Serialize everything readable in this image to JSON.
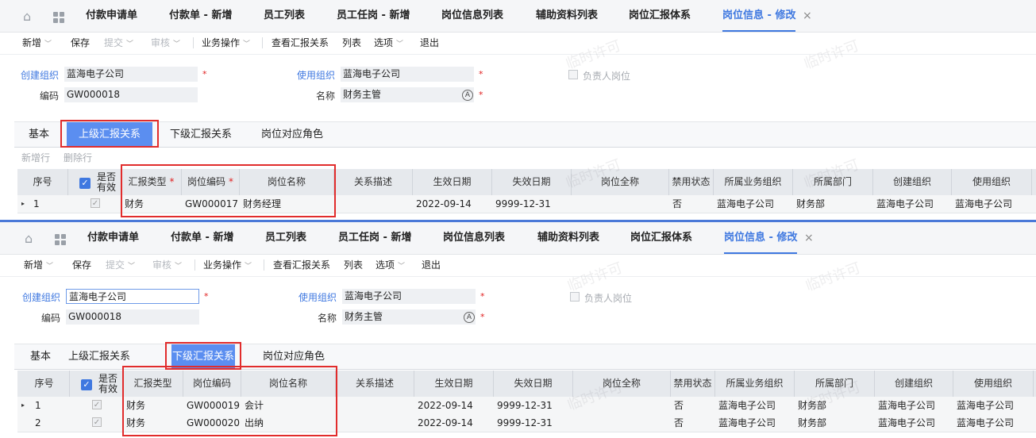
{
  "tabs": [
    "付款申请单",
    "付款单 - 新增",
    "员工列表",
    "员工任岗 - 新增",
    "岗位信息列表",
    "辅助资料列表",
    "岗位汇报体系",
    "岗位信息 - 修改"
  ],
  "tab_close": "×",
  "home_icon": "⌂",
  "toolbar": {
    "new": "新增",
    "save": "保存",
    "submit": "提交",
    "audit": "审核",
    "business": "业务操作",
    "view_report": "查看汇报关系",
    "list": "列表",
    "options": "选项",
    "exit": "退出",
    "caret": "﹀"
  },
  "form": {
    "create_org_label": "创建组织",
    "create_org": "蓝海电子公司",
    "use_org_label": "使用组织",
    "use_org": "蓝海电子公司",
    "code_label": "编码",
    "code": "GW000018",
    "name_label": "名称",
    "name": "财务主管",
    "leader_label": "负责人岗位",
    "required": "*"
  },
  "subtabs": [
    "基本",
    "上级汇报关系",
    "下级汇报关系",
    "岗位对应角色"
  ],
  "row_actions": {
    "add": "新增行",
    "delete": "删除行"
  },
  "grid": {
    "columns": [
      "序号",
      "是否有效",
      "汇报类型",
      "岗位编码",
      "岗位名称",
      "关系描述",
      "生效日期",
      "失效日期",
      "岗位全称",
      "禁用状态",
      "所属业务组织",
      "所属部门",
      "创建组织",
      "使用组织"
    ],
    "valid_line1": "是否",
    "valid_line2": "有效",
    "check": "✓",
    "req": "*"
  },
  "panel1": {
    "active_subtab": 1,
    "rows": [
      {
        "seq": "1",
        "type": "财务",
        "code": "GW000017",
        "name": "财务经理",
        "start": "2022-09-14",
        "end": "9999-12-31",
        "disabled": "否",
        "biz_org": "蓝海电子公司",
        "dept": "财务部",
        "create_org": "蓝海电子公司",
        "use_org": "蓝海电子公司"
      }
    ]
  },
  "panel2": {
    "active_subtab": 2,
    "rows": [
      {
        "seq": "1",
        "type": "财务",
        "code": "GW000019",
        "name": "会计",
        "start": "2022-09-14",
        "end": "9999-12-31",
        "disabled": "否",
        "biz_org": "蓝海电子公司",
        "dept": "财务部",
        "create_org": "蓝海电子公司",
        "use_org": "蓝海电子公司"
      },
      {
        "seq": "2",
        "type": "财务",
        "code": "GW000020",
        "name": "出纳",
        "start": "2022-09-14",
        "end": "9999-12-31",
        "disabled": "否",
        "biz_org": "蓝海电子公司",
        "dept": "财务部",
        "create_org": "蓝海电子公司",
        "use_org": "蓝海电子公司"
      }
    ]
  },
  "watermark": "临时许可",
  "colors": {
    "accent": "#3f78e0",
    "subtab_active": "#5b8ef0",
    "highlight": "#e12c2c"
  }
}
